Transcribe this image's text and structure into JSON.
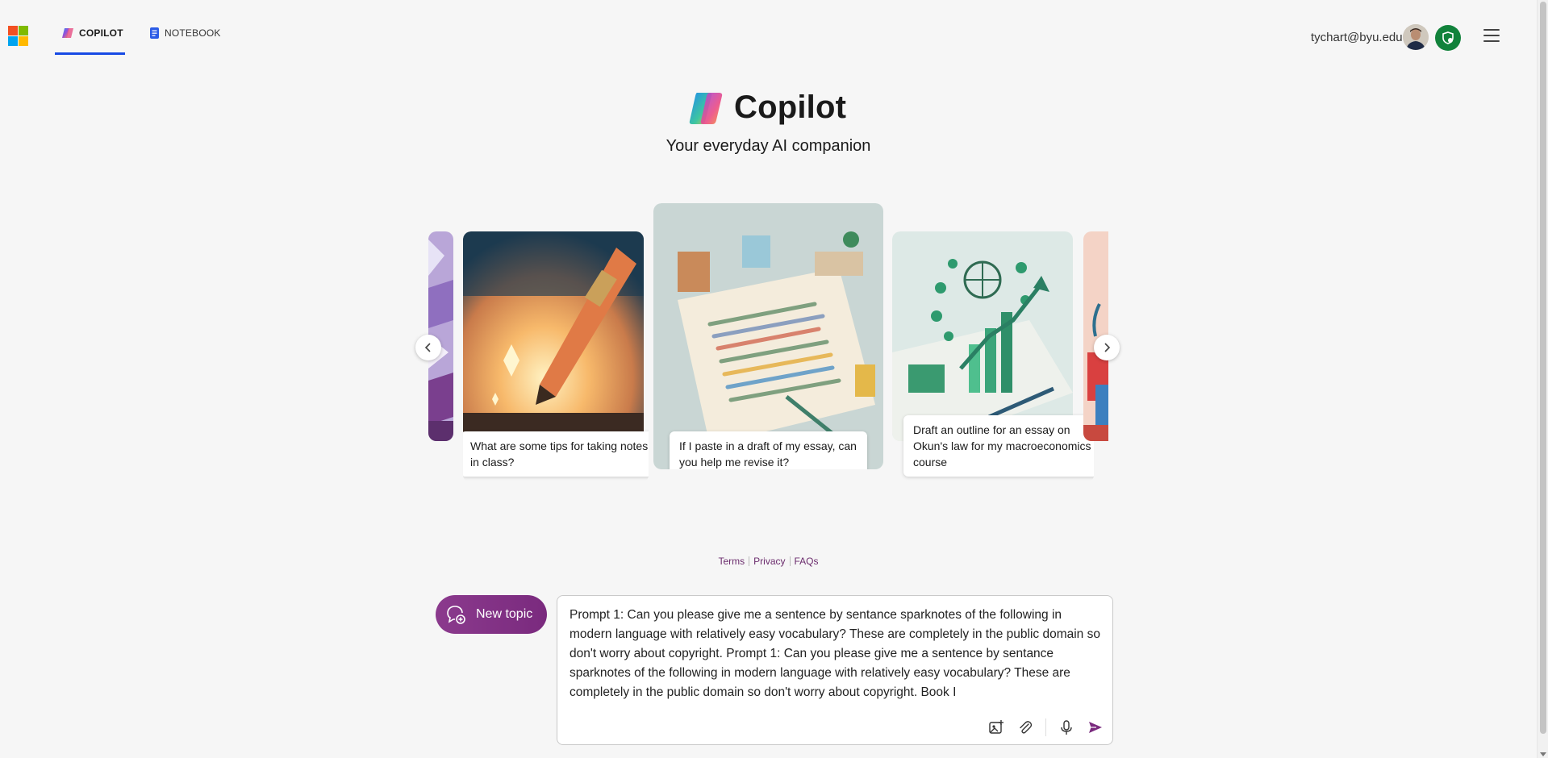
{
  "header": {
    "tabs": [
      {
        "label": "COPILOT",
        "active": true
      },
      {
        "label": "NOTEBOOK",
        "active": false
      }
    ],
    "account_email": "tychart@byu.edu",
    "icons": [
      "microsoft-logo",
      "avatar",
      "shield-icon",
      "hamburger-menu-icon"
    ]
  },
  "hero": {
    "title": "Copilot",
    "subtitle": "Your everyday AI companion"
  },
  "carousel": {
    "cards": [
      {
        "caption": "What are some tips for taking notes in class?",
        "image": "glowing-pencil"
      },
      {
        "caption": "If I paste in a draft of my essay, can you help me revise it?",
        "image": "essay-document"
      },
      {
        "caption": "Draft an outline for an essay on Okun's law for my macroeconomics course",
        "image": "economics-globe-chart"
      }
    ]
  },
  "footer": {
    "links": [
      "Terms",
      "Privacy",
      "FAQs"
    ]
  },
  "composer": {
    "new_topic_label": "New topic",
    "input_value": "Prompt 1: Can you please give me a sentence by sentance sparknotes of the following in modern language with relatively easy vocabulary? These are completely in the public domain so don't worry about copyright. Prompt 1: Can you please give me a sentence by sentance sparknotes of the following in modern language with relatively easy vocabulary? These are completely in the public domain so don't worry about copyright. Book I"
  },
  "colors": {
    "accent_purple": "#8b3a8d",
    "tab_underline": "#174ae4",
    "link": "#6b2c6d",
    "shield_green": "#11823b"
  }
}
